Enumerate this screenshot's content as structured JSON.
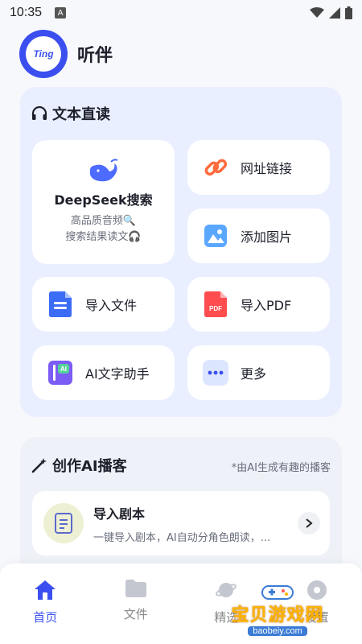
{
  "status_bar": {
    "time": "10:35",
    "notification_letter": "A"
  },
  "app": {
    "logo_text": "Ting",
    "name": "听伴"
  },
  "read_section": {
    "title": "文本直读",
    "deepseek": {
      "title": "DeepSeek搜索",
      "line1": "高品质音频🔍",
      "line2": "搜索结果读文🎧"
    },
    "tiles": {
      "url": "网址链接",
      "image": "添加图片",
      "file": "导入文件",
      "pdf": "导入PDF",
      "pdf_badge": "PDF",
      "ai_writer": "AI文字助手",
      "ai_badge": "AI",
      "more": "更多"
    }
  },
  "ai_section": {
    "title": "创作AI播客",
    "note": "*由AI生成有趣的播客",
    "script": {
      "title": "导入剧本",
      "desc": "一键导入剧本，AI自动分角色朗读，..."
    }
  },
  "tabs": [
    {
      "label": "首页",
      "active": true
    },
    {
      "label": "文件",
      "active": false
    },
    {
      "label": "精选",
      "active": false
    },
    {
      "label": "设置",
      "active": false
    }
  ],
  "watermark": {
    "main": "宝贝游戏网",
    "sub": "baobeiy.com"
  },
  "colors": {
    "accent": "#3b4ff0",
    "card_bg": "#e9efff"
  }
}
